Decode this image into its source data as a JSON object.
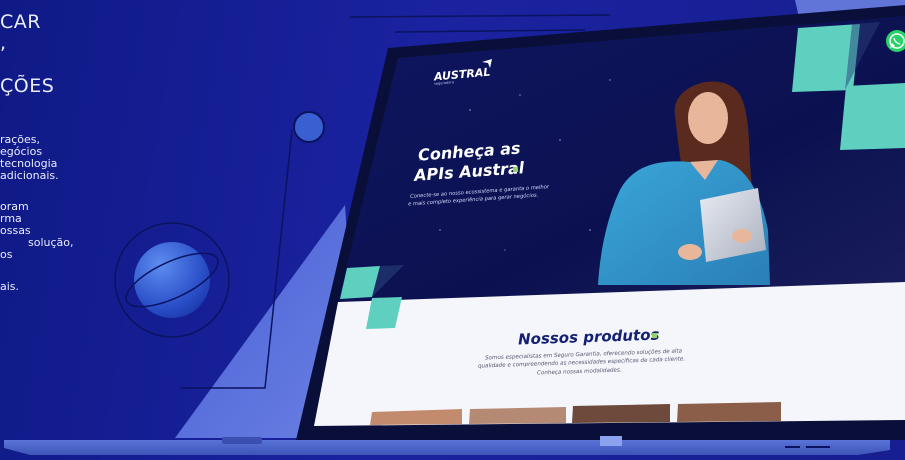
{
  "left_panel": {
    "heading_lines": [
      "CAR",
      ",",
      "",
      "ÇÕES"
    ],
    "body_lines": [
      "rações,",
      "egócios",
      "tecnologia",
      "adicionais.",
      "",
      "oram",
      "rma",
      "ossas",
      "solução,",
      "os",
      "",
      "ais."
    ]
  },
  "site": {
    "logo": "AUSTRAL",
    "logo_sub": "seguradora",
    "hero": {
      "title_line1": "Conheça as",
      "title_line2": "APIs Austral",
      "subtitle_line1": "Conecte-se ao nosso ecossistema e garanta o melhor",
      "subtitle_line2": "e mais completo experiência para gerar negócios."
    },
    "products": {
      "title": "Nossos produtos",
      "desc_line1": "Somos especialistas em Seguro Garantia, oferecendo soluções de alta",
      "desc_line2": "qualidade e compreendendo as necessidades específicas de cada cliente.",
      "desc_line3": "Conheça nossas modalidades."
    }
  },
  "colors": {
    "background": "#1a22a0",
    "accent_teal": "#5fd0c0",
    "accent_green": "#8fd36a",
    "whatsapp": "#25d366",
    "navy": "#152073"
  },
  "icons": [
    "whatsapp-icon",
    "austral-logo-icon"
  ]
}
